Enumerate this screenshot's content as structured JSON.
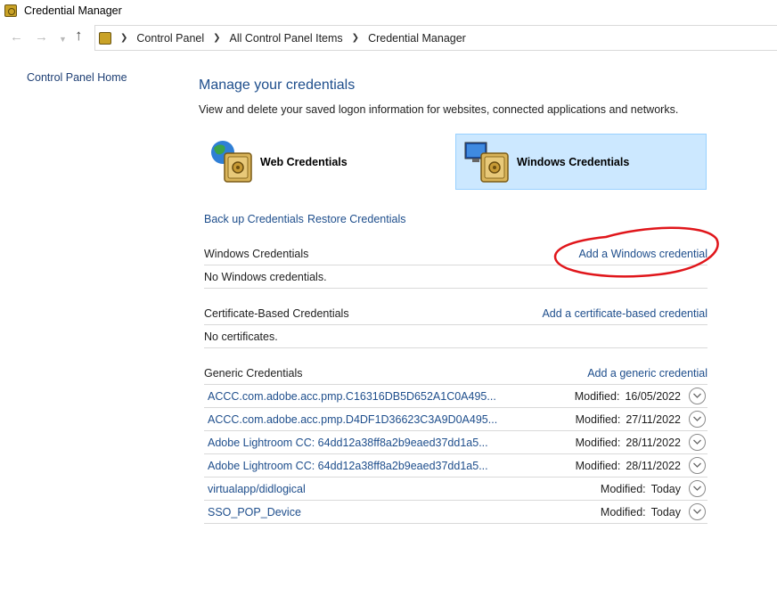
{
  "window": {
    "title": "Credential Manager"
  },
  "breadcrumb": [
    "Control Panel",
    "All Control Panel Items",
    "Credential Manager"
  ],
  "left_pane": {
    "home_link": "Control Panel Home"
  },
  "main": {
    "title": "Manage your credentials",
    "description": "View and delete your saved logon information for websites, connected applications and networks.",
    "tiles": [
      {
        "label": "Web Credentials",
        "selected": false
      },
      {
        "label": "Windows Credentials",
        "selected": true
      }
    ],
    "links": {
      "backup": "Back up Credentials",
      "restore": "Restore Credentials"
    }
  },
  "sections": {
    "windows": {
      "title": "Windows Credentials",
      "action": "Add a Windows credential",
      "empty": "No Windows credentials."
    },
    "certificate": {
      "title": "Certificate-Based Credentials",
      "action": "Add a certificate-based credential",
      "empty": "No certificates."
    },
    "generic": {
      "title": "Generic Credentials",
      "action": "Add a generic credential",
      "modified_label": "Modified:",
      "items": [
        {
          "name": "ACCC.com.adobe.acc.pmp.C16316DB5D652A1C0A495...",
          "modified": "16/05/2022"
        },
        {
          "name": "ACCC.com.adobe.acc.pmp.D4DF1D36623C3A9D0A495...",
          "modified": "27/11/2022"
        },
        {
          "name": "Adobe Lightroom CC: 64dd12a38ff8a2b9eaed37dd1a5...",
          "modified": "28/11/2022"
        },
        {
          "name": "Adobe Lightroom CC: 64dd12a38ff8a2b9eaed37dd1a5...",
          "modified": "28/11/2022"
        },
        {
          "name": "virtualapp/didlogical",
          "modified": "Today"
        },
        {
          "name": "SSO_POP_Device",
          "modified": "Today"
        }
      ]
    }
  },
  "colors": {
    "link": "#1e4e8c",
    "selected_tile": "#cce8ff",
    "annotation": "#e0161b"
  }
}
